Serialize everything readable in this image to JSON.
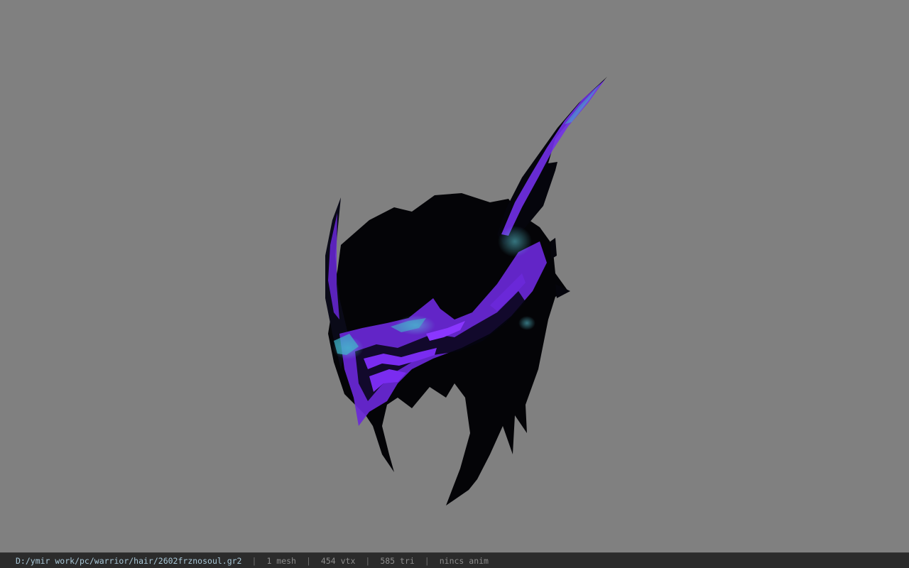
{
  "viewer": {
    "background_color": "#808080",
    "model_subject": "hair-mesh"
  },
  "status": {
    "path": "D:/ymir work/pc/warrior/hair/2602frznosoul.gr2",
    "separator": "|",
    "mesh": "1 mesh",
    "vtx": "454 vtx",
    "tri": "585 tri",
    "anim": "nincs anim"
  },
  "colors": {
    "mesh_dark": "#040408",
    "accent_purple": "#7a2cf0",
    "accent_cyan": "#3fb7c9"
  }
}
